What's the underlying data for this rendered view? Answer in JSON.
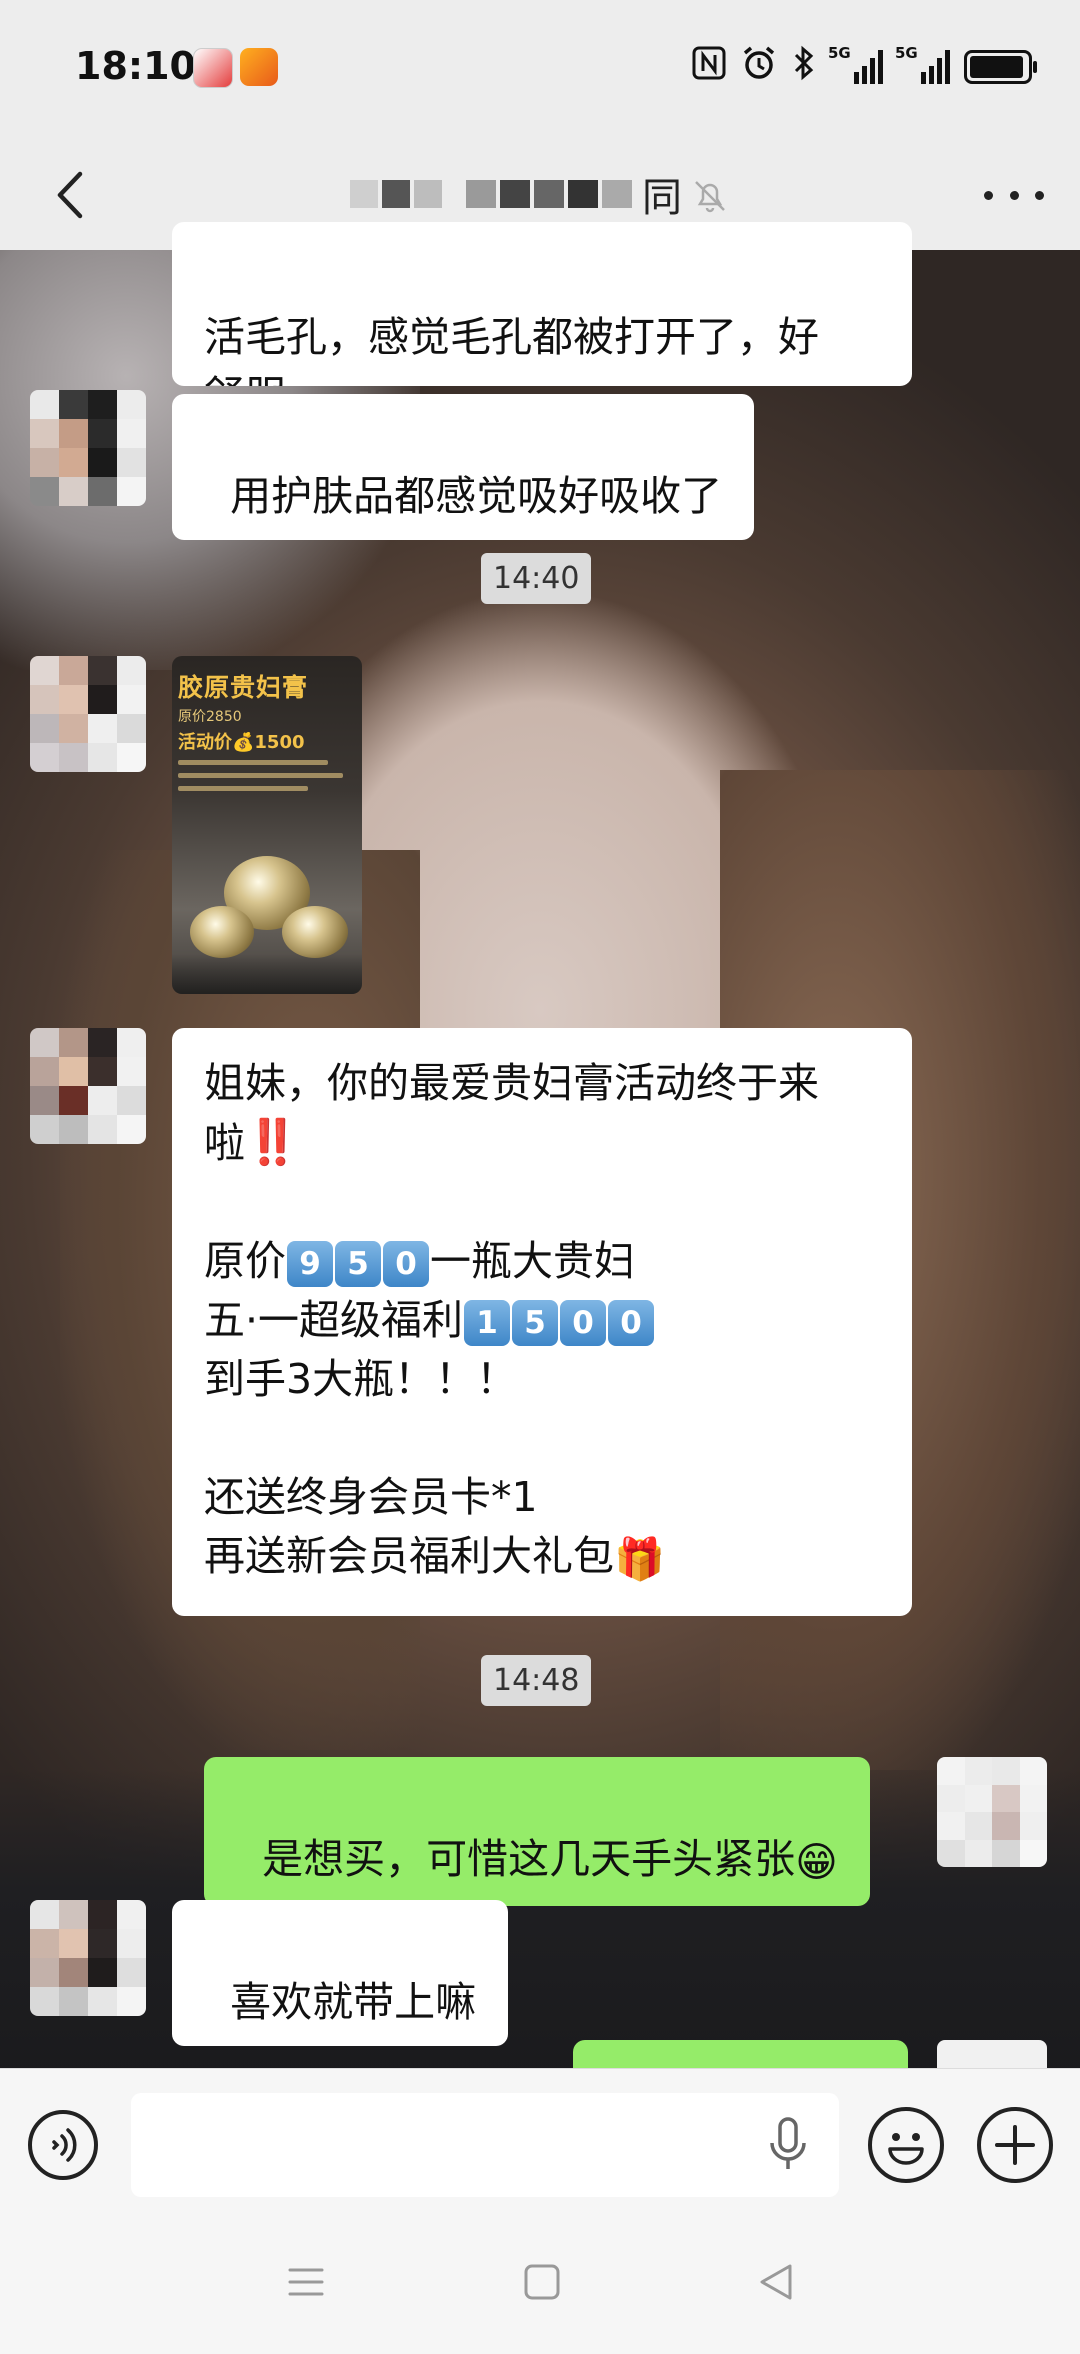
{
  "status_bar": {
    "time": "18:10",
    "network_labels": [
      "5G",
      "5G"
    ],
    "icons": [
      "nfc-icon",
      "alarm-icon",
      "bluetooth-icon",
      "signal-icon",
      "signal-icon",
      "battery-icon"
    ]
  },
  "header": {
    "title_visible_char": "同",
    "back_icon": "chevron-left-icon",
    "mute_icon": "bell-off-icon",
    "more_icon": "more-dots-icon"
  },
  "messages": [
    {
      "side": "in",
      "type": "text",
      "text": "活毛孔，感觉毛孔都被打开了，好\n舒服"
    },
    {
      "side": "in",
      "type": "text",
      "text": "用护肤品都感觉吸好吸收了"
    },
    {
      "type": "time",
      "text": "14:40"
    },
    {
      "side": "in",
      "type": "image",
      "image_title": "胶原贵妇膏",
      "image_small": "原价2850",
      "image_price": "活动价💰1500"
    },
    {
      "side": "in",
      "type": "text",
      "line1": "姐妹，你的最爱贵妇膏活动终于来",
      "line2": "啦",
      "line2_emoji": "‼️",
      "line3_pre": "原价",
      "line3_digits": [
        "9",
        "5",
        "0"
      ],
      "line3_post": "一瓶大贵妇",
      "line4_pre": "五·一超级福利",
      "line4_digits": [
        "1",
        "5",
        "0",
        "0"
      ],
      "line5": "到手3大瓶！！！",
      "line6": "还送终身会员卡*1",
      "line7": "再送新会员福利大礼包",
      "line7_emoji": "🎁"
    },
    {
      "type": "time",
      "text": "14:48"
    },
    {
      "side": "out",
      "type": "text",
      "text": "是想买，可惜这几天手头紧张",
      "emoji": "😁"
    },
    {
      "side": "in",
      "type": "text",
      "text": "喜欢就带上嘛"
    }
  ],
  "input_bar": {
    "text_value": "",
    "voice_icon": "voice-icon",
    "mic_icon": "microphone-icon",
    "emoji_icon": "smiley-icon",
    "plus_icon": "plus-icon"
  },
  "nav_bar": {
    "icons": [
      "menu-icon",
      "home-icon",
      "back-icon"
    ]
  },
  "colors": {
    "bubble_in": "#ffffff",
    "bubble_out": "#95ec69",
    "header_bg": "#ededed",
    "time_chip": "#dcdcdc"
  }
}
